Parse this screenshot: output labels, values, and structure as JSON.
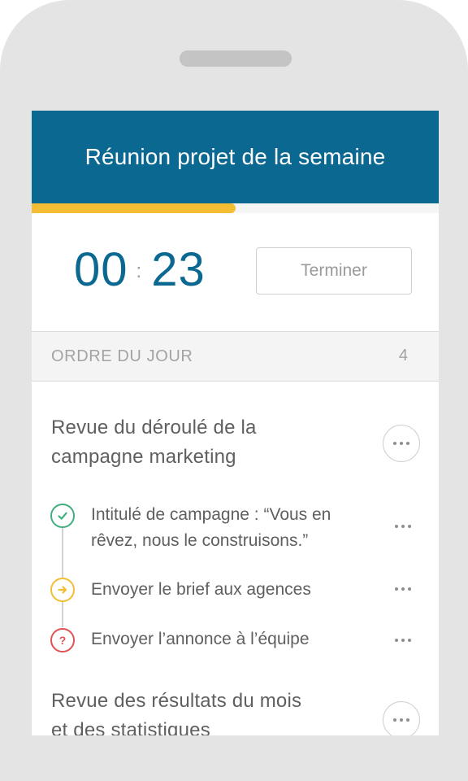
{
  "meeting": {
    "title": "Réunion projet de la semaine",
    "progress": 0.5
  },
  "timer": {
    "minutes": "00",
    "separator": ":",
    "seconds": "23",
    "finish_label": "Terminer"
  },
  "agenda": {
    "label": "ORDRE DU JOUR",
    "count": "4",
    "sections": [
      {
        "title_line1": "Revue du déroulé de la",
        "title_line2": "campagne marketing",
        "tasks": [
          {
            "line1": "Intitulé de campagne : “Vous en",
            "line2": "rêvez, nous le construisons.”",
            "status": "done",
            "status_icon": "check-icon",
            "color": "#3fae7d"
          },
          {
            "line1": "Envoyer le brief aux agences",
            "status": "in-progress",
            "status_icon": "arrow-right-icon",
            "color": "#f4bd34"
          },
          {
            "line1": "Envoyer  l’annonce à l’équipe",
            "status": "question",
            "status_icon": "question-icon",
            "color": "#e05255"
          }
        ]
      },
      {
        "title_line1": "Revue des résultats du mois",
        "title_line2": "et des statistiques"
      }
    ]
  },
  "colors": {
    "header": "#0b6890",
    "progress": "#f4bd34",
    "timer": "#0b6890"
  }
}
